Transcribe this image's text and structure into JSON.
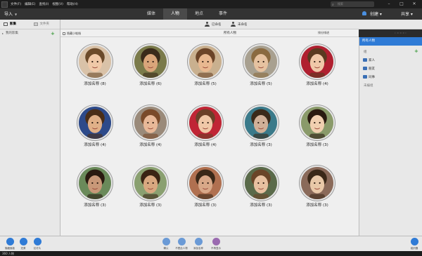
{
  "menu": [
    "文件(F)",
    "编辑(E)",
    "查找(I)",
    "视图(V)",
    "帮助(H)"
  ],
  "search": {
    "placeholder": "搜索"
  },
  "toolbar": {
    "import_label": "导入",
    "create_label": "创建",
    "share_label": "共享"
  },
  "tabs": [
    "媒体",
    "人物",
    "地点",
    "事件"
  ],
  "active_tab": "人物",
  "left_panel": {
    "tab_media": "影集",
    "tab_folders": "文件夹",
    "my_albums": "我的影集"
  },
  "subbar": {
    "named": "已命名",
    "unnamed": "未命名"
  },
  "bar2": {
    "hide_small": "隐藏小堆栈",
    "all_people": "所有人物",
    "sort": "排分排进"
  },
  "faces": [
    {
      "label": "添加名称 (8)",
      "bg": "#d9c2a8",
      "skin": "#f0c9a8",
      "hair": "#6b4a2a"
    },
    {
      "label": "添加名称 (6)",
      "bg": "#7a7a4a",
      "skin": "#d9a57a",
      "hair": "#3a2a1a"
    },
    {
      "label": "添加名称 (5)",
      "bg": "#c9b08f",
      "skin": "#e8b890",
      "hair": "#6b4428"
    },
    {
      "label": "添加名称 (5)",
      "bg": "#a8a090",
      "skin": "#e6c2a0",
      "hair": "#8a6a40"
    },
    {
      "label": "添加名称 (4)",
      "bg": "#b02030",
      "skin": "#f0c8a8",
      "hair": "#5a3a20"
    },
    {
      "label": "添加名称 (4)",
      "bg": "#2d4a8a",
      "skin": "#e0b088",
      "hair": "#4a2e18"
    },
    {
      "label": "添加名称 (4)",
      "bg": "#9a8a7a",
      "skin": "#e8b898",
      "hair": "#7a4a2a"
    },
    {
      "label": "添加名称 (4)",
      "bg": "#c02535",
      "skin": "#f0c8a8",
      "hair": "#6a4028"
    },
    {
      "label": "添加名称 (3)",
      "bg": "#3a7a8a",
      "skin": "#d0b098",
      "hair": "#3a2a1a"
    },
    {
      "label": "添加名称 (3)",
      "bg": "#8a9a6a",
      "skin": "#f0cfb0",
      "hair": "#2a1a10"
    },
    {
      "label": "添加名称 (3)",
      "bg": "#6a8a5a",
      "skin": "#c89878",
      "hair": "#2a1a10"
    },
    {
      "label": "添加名称 (3)",
      "bg": "#8aa070",
      "skin": "#d8a880",
      "hair": "#3a2414"
    },
    {
      "label": "添加名称 (3)",
      "bg": "#b07050",
      "skin": "#d8a888",
      "hair": "#3a2818"
    },
    {
      "label": "添加名称 (3)",
      "bg": "#5a6a4a",
      "skin": "#e8c0a0",
      "hair": "#6a4428"
    },
    {
      "label": "添加名称 (3)",
      "bg": "#8a6a5a",
      "skin": "#e8c8a8",
      "hair": "#3a2818"
    }
  ],
  "right_panel": {
    "header": "所有人物",
    "group_label": "组",
    "groups": [
      "家人",
      "朋友",
      "同事"
    ],
    "untagged": "未编组"
  },
  "bottom_tools": [
    {
      "label": "隐藏面板",
      "color": "#2f7bd6"
    },
    {
      "label": "还原",
      "color": "#2f7bd6"
    },
    {
      "label": "幻灯片",
      "color": "#2f7bd6"
    },
    {
      "label": "确认",
      "color": "#6a9ad6"
    },
    {
      "label": "不是此人物",
      "color": "#6a9ad6"
    },
    {
      "label": "添加名称",
      "color": "#6a9ad6"
    },
    {
      "label": "不再显示",
      "color": "#9a6ab0"
    },
    {
      "label": "组织器",
      "color": "#2f7bd6"
    }
  ],
  "status": "360 人物"
}
